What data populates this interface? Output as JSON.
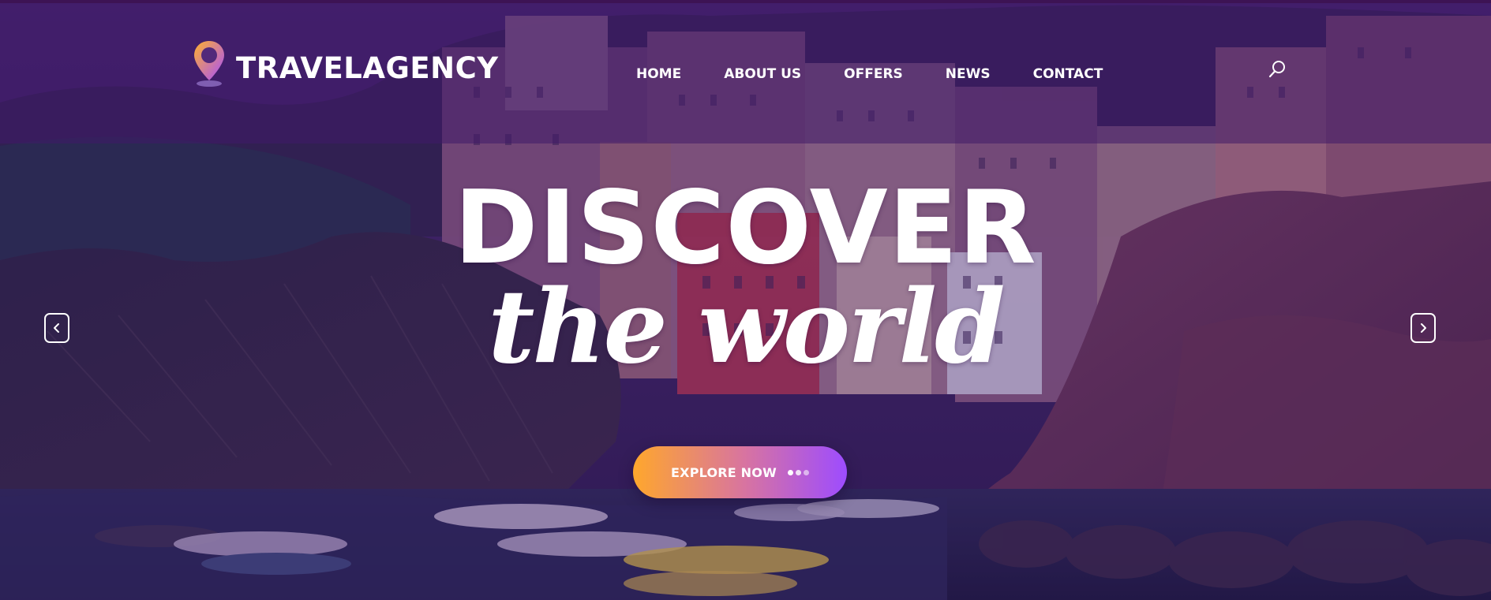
{
  "brand": {
    "name": "TRAVELAGENCY",
    "logo_icon": "map-pin-icon"
  },
  "nav": {
    "items": [
      {
        "label": "HOME"
      },
      {
        "label": "ABOUT US"
      },
      {
        "label": "OFFERS"
      },
      {
        "label": "NEWS"
      },
      {
        "label": "CONTACT"
      }
    ],
    "search_icon": "search-icon"
  },
  "hero": {
    "headline": "DISCOVER",
    "subheadline": "the world",
    "cta_label": "EXPLORE NOW",
    "prev_icon": "chevron-left-icon",
    "next_icon": "chevron-right-icon"
  },
  "colors": {
    "overlay": "#401a68",
    "cta_start": "#ffa72c",
    "cta_end": "#9d4cff",
    "text": "#ffffff"
  }
}
